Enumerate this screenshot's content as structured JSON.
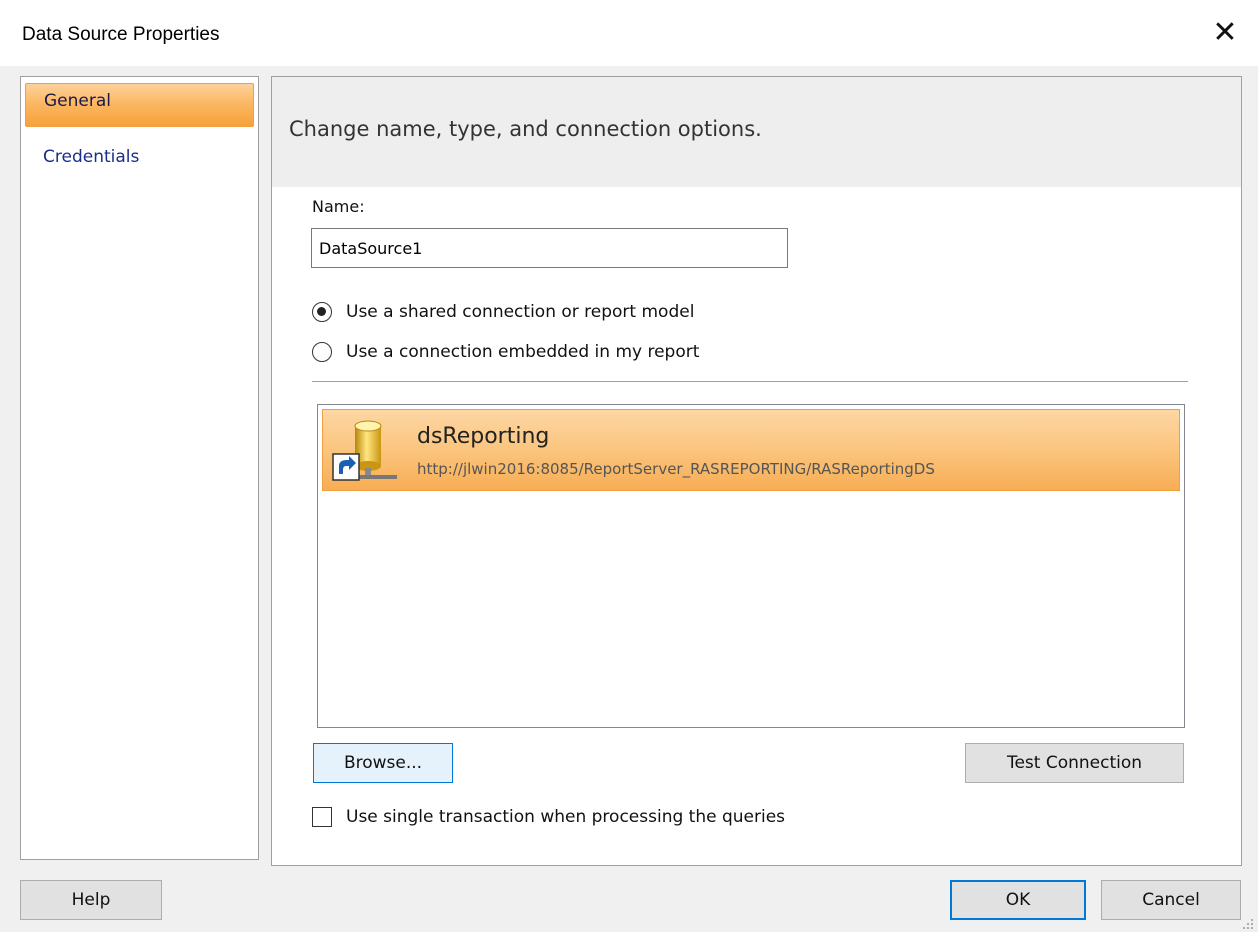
{
  "window": {
    "title": "Data Source Properties",
    "close_glyph": "✕"
  },
  "nav": {
    "items": [
      {
        "label": "General",
        "selected": true
      },
      {
        "label": "Credentials",
        "selected": false
      }
    ]
  },
  "content": {
    "header": "Change name, type, and connection options.",
    "name_label": "Name:",
    "name_value": "DataSource1",
    "radio_options": [
      {
        "label": "Use a shared connection or report model",
        "checked": true
      },
      {
        "label": "Use a connection embedded in my report",
        "checked": false
      }
    ],
    "shared_source": {
      "name": "dsReporting",
      "path": "http://jlwin2016:8085/ReportServer_RASREPORTING/RASReportingDS",
      "icon": "database-shortcut-icon"
    },
    "browse_label": "Browse...",
    "test_connection_label": "Test Connection",
    "single_transaction_label": "Use single transaction when processing the queries",
    "single_transaction_checked": false
  },
  "footer": {
    "help_label": "Help",
    "ok_label": "OK",
    "cancel_label": "Cancel"
  },
  "colors": {
    "selection_orange": "#fbb863",
    "focus_blue": "#0078d7",
    "nav_link_blue": "#1a2c8c"
  }
}
